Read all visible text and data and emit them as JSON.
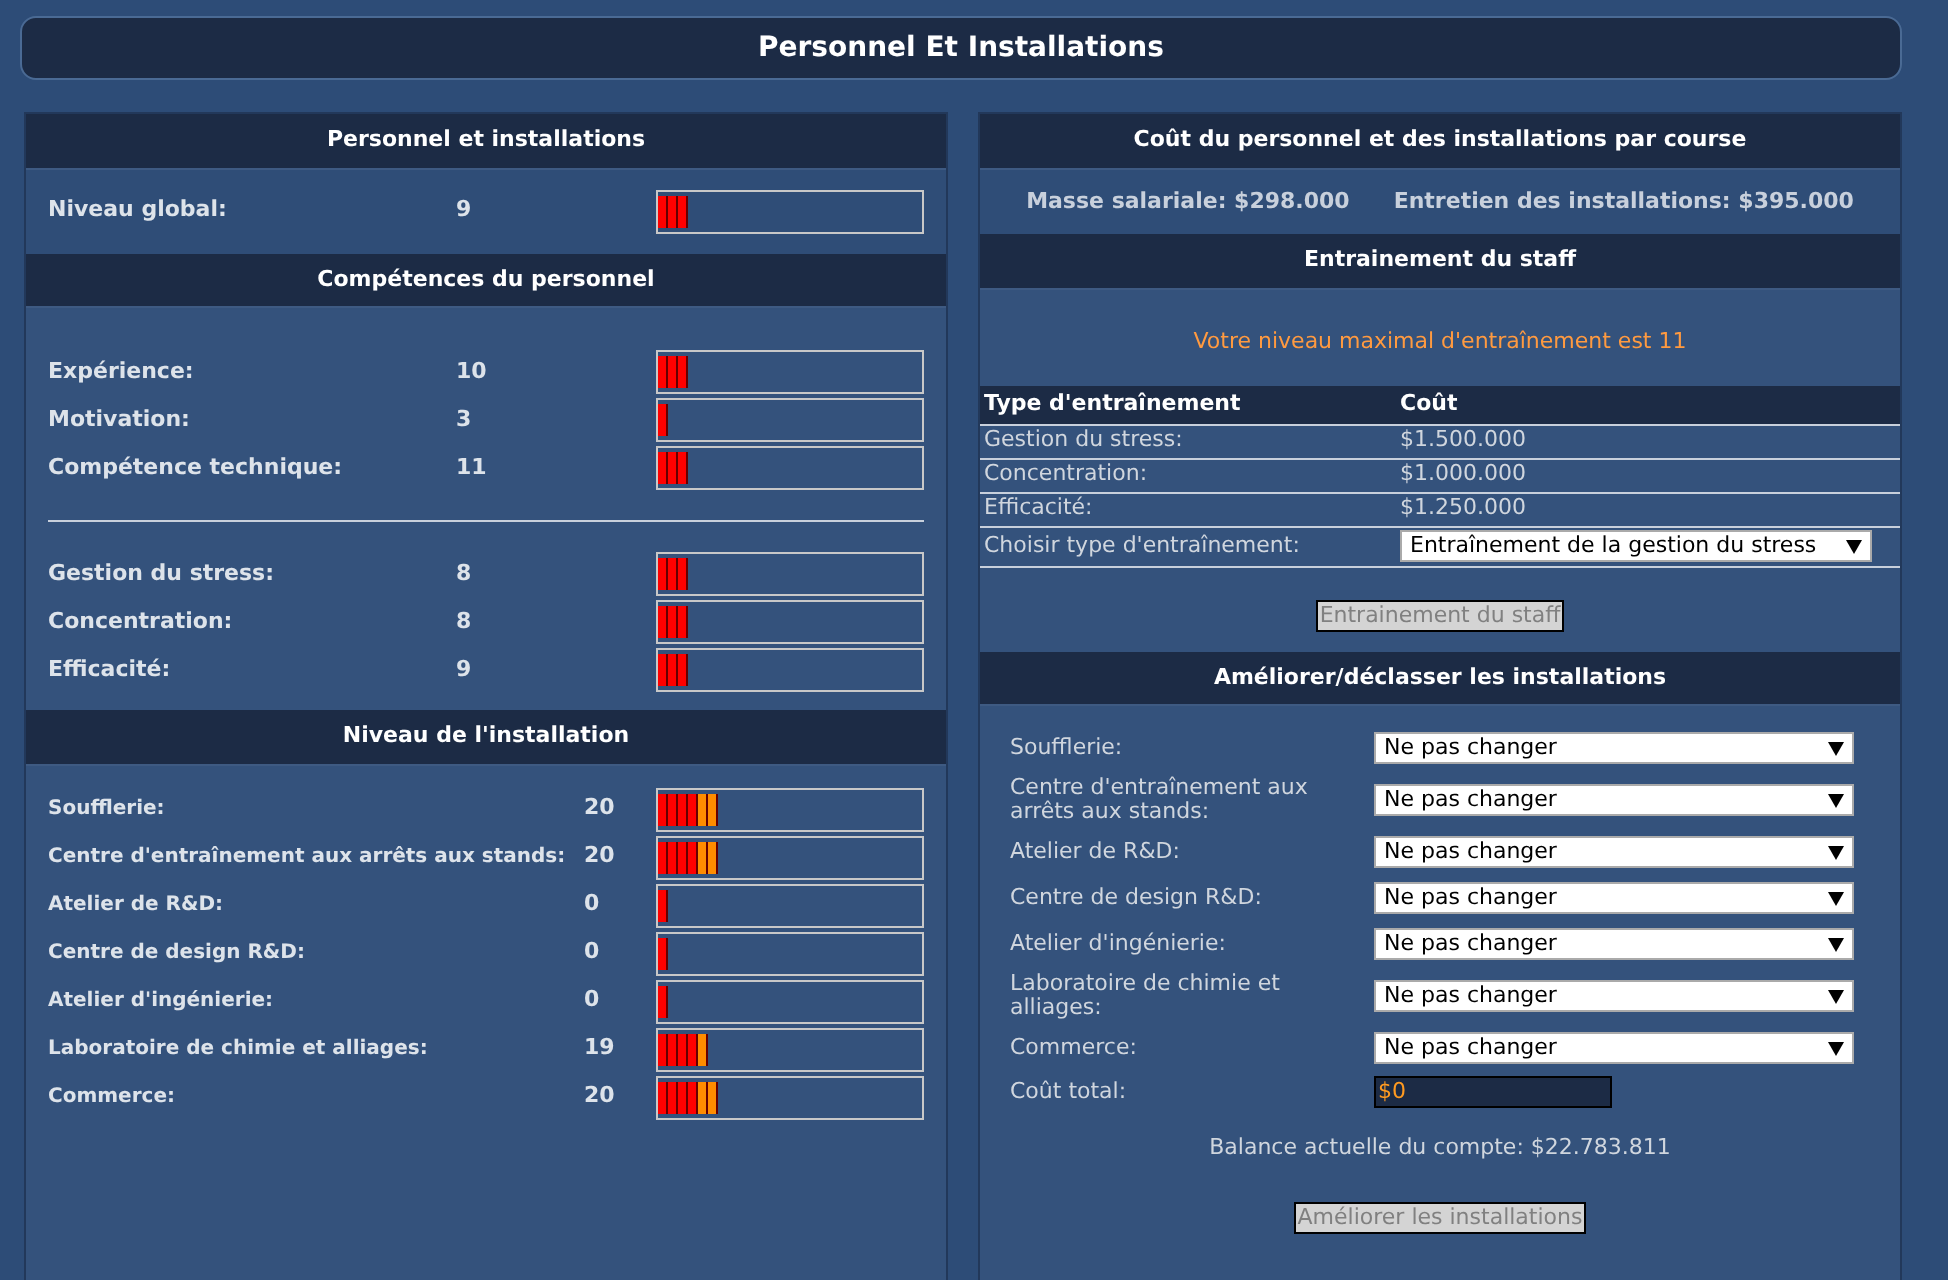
{
  "page_title": "Personnel Et Installations",
  "left": {
    "overview": {
      "title": "Personnel et installations",
      "rows": [
        {
          "label": "Niveau global:",
          "value": "9",
          "level": 0.11
        }
      ]
    },
    "skills": {
      "title": "Compétences du personnel",
      "groups": [
        [
          {
            "label": "Expérience:",
            "value": "10",
            "level": 0.11
          },
          {
            "label": "Motivation:",
            "value": "3",
            "level": 0.04
          },
          {
            "label": "Compétence technique:",
            "value": "11",
            "level": 0.11
          }
        ],
        [
          {
            "label": "Gestion du stress:",
            "value": "8",
            "level": 0.11
          },
          {
            "label": "Concentration:",
            "value": "8",
            "level": 0.11
          },
          {
            "label": "Efficacité:",
            "value": "9",
            "level": 0.11
          }
        ]
      ]
    },
    "facilities": {
      "title": "Niveau de l'installation",
      "rows": [
        {
          "label": "Soufflerie:",
          "value": "20",
          "level": 0.23
        },
        {
          "label": "Centre d'entraînement aux arrêts aux stands:",
          "value": "20",
          "level": 0.23
        },
        {
          "label": "Atelier de R&D:",
          "value": "0",
          "level": 0.04
        },
        {
          "label": "Centre de design R&D:",
          "value": "0",
          "level": 0.04
        },
        {
          "label": "Atelier d'ingénierie:",
          "value": "0",
          "level": 0.04
        },
        {
          "label": "Laboratoire de chimie et alliages:",
          "value": "19",
          "level": 0.19
        },
        {
          "label": "Commerce:",
          "value": "20",
          "level": 0.23
        }
      ]
    }
  },
  "right": {
    "costs": {
      "title": "Coût du personnel et des installations par course",
      "salary": "Masse salariale: $298.000",
      "upkeep": "Entretien des installations: $395.000"
    },
    "training": {
      "title": "Entrainement du staff",
      "notice": "Votre niveau maximal d'entraînement est 11",
      "columns": [
        "Type d'entraînement",
        "Coût"
      ],
      "rows": [
        {
          "type": "Gestion du stress:",
          "cost": "$1.500.000"
        },
        {
          "type": "Concentration:",
          "cost": "$1.000.000"
        },
        {
          "type": "Efficacité:",
          "cost": "$1.250.000"
        }
      ],
      "choose_label": "Choisir type d'entraînement:",
      "choose_value": "Entraînement de la gestion du stress",
      "button": "Entrainement du staff"
    },
    "upgrade": {
      "title": "Améliorer/déclasser les installations",
      "rows": [
        {
          "label": "Soufflerie:",
          "value": "Ne pas changer"
        },
        {
          "label": "Centre d'entraînement aux arrêts aux stands:",
          "value": "Ne pas changer"
        },
        {
          "label": "Atelier de R&D:",
          "value": "Ne pas changer"
        },
        {
          "label": "Centre de design R&D:",
          "value": "Ne pas changer"
        },
        {
          "label": "Atelier d'ingénierie:",
          "value": "Ne pas changer"
        },
        {
          "label": "Laboratoire de chimie et alliages:",
          "value": "Ne pas changer"
        },
        {
          "label": "Commerce:",
          "value": "Ne pas changer"
        }
      ],
      "total_label": "Coût total:",
      "total_value": "$0",
      "balance": "Balance actuelle du compte: $22.783.811",
      "button": "Améliorer les installations"
    }
  }
}
